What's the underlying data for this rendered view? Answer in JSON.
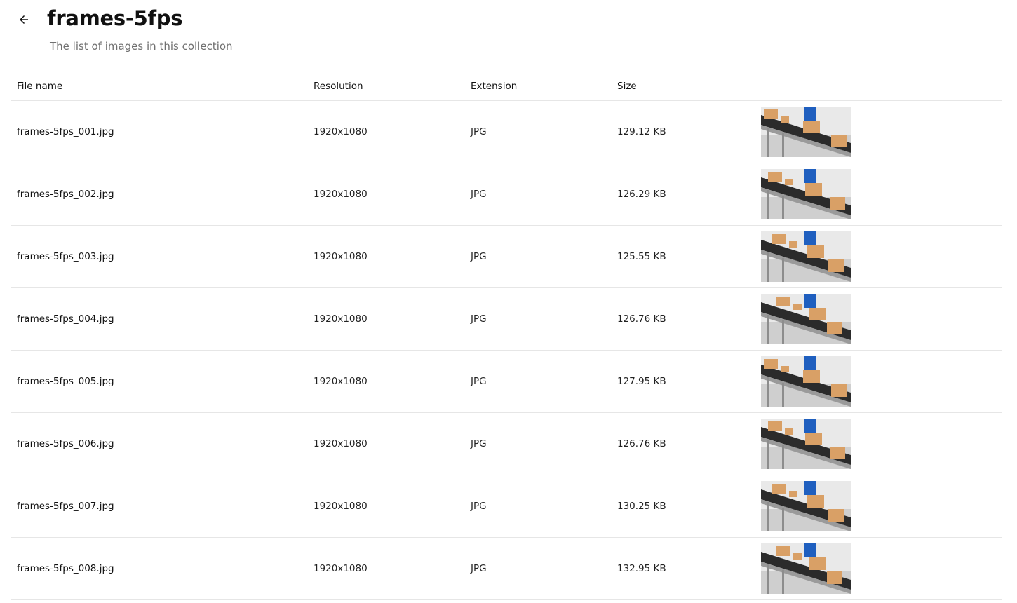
{
  "header": {
    "title": "frames-5fps",
    "subtitle": "The list of images in this collection",
    "back_icon": "arrow-left-icon"
  },
  "table": {
    "columns": [
      "File name",
      "Resolution",
      "Extension",
      "Size",
      ""
    ],
    "rows": [
      {
        "name": "frames-5fps_001.jpg",
        "resolution": "1920x1080",
        "extension": "JPG",
        "size": "129.12 KB"
      },
      {
        "name": "frames-5fps_002.jpg",
        "resolution": "1920x1080",
        "extension": "JPG",
        "size": "126.29 KB"
      },
      {
        "name": "frames-5fps_003.jpg",
        "resolution": "1920x1080",
        "extension": "JPG",
        "size": "125.55 KB"
      },
      {
        "name": "frames-5fps_004.jpg",
        "resolution": "1920x1080",
        "extension": "JPG",
        "size": "126.76 KB"
      },
      {
        "name": "frames-5fps_005.jpg",
        "resolution": "1920x1080",
        "extension": "JPG",
        "size": "127.95 KB"
      },
      {
        "name": "frames-5fps_006.jpg",
        "resolution": "1920x1080",
        "extension": "JPG",
        "size": "126.76 KB"
      },
      {
        "name": "frames-5fps_007.jpg",
        "resolution": "1920x1080",
        "extension": "JPG",
        "size": "130.25 KB"
      },
      {
        "name": "frames-5fps_008.jpg",
        "resolution": "1920x1080",
        "extension": "JPG",
        "size": "132.95 KB"
      }
    ]
  },
  "colors": {
    "text": "#111111",
    "subtitle": "#707070",
    "divider": "#e6e6e6",
    "box": "#d9a066",
    "belt": "#2b2b2b",
    "worker_shirt": "#1f5fbf"
  }
}
